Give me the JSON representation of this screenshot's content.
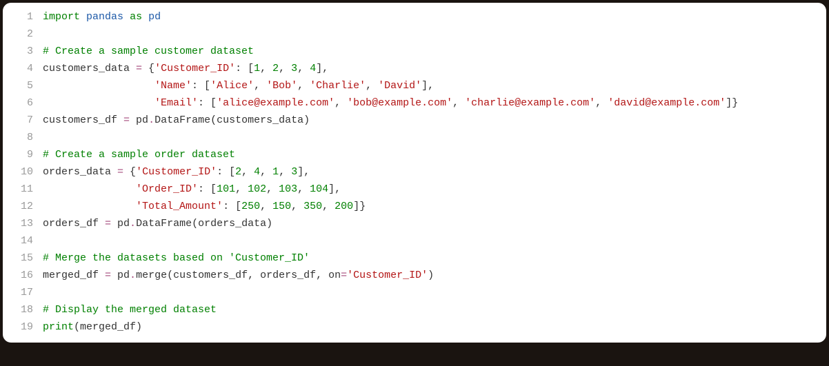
{
  "code": {
    "lines": [
      {
        "num": "1",
        "tokens": [
          {
            "cls": "kw",
            "t": "import"
          },
          {
            "cls": "pn",
            "t": " "
          },
          {
            "cls": "nm",
            "t": "pandas"
          },
          {
            "cls": "pn",
            "t": " "
          },
          {
            "cls": "kw",
            "t": "as"
          },
          {
            "cls": "pn",
            "t": " "
          },
          {
            "cls": "nm",
            "t": "pd"
          }
        ]
      },
      {
        "num": "2",
        "tokens": []
      },
      {
        "num": "3",
        "tokens": [
          {
            "cls": "cm",
            "t": "# Create a sample customer dataset"
          }
        ]
      },
      {
        "num": "4",
        "tokens": [
          {
            "cls": "pn",
            "t": "customers_data "
          },
          {
            "cls": "op",
            "t": "="
          },
          {
            "cls": "pn",
            "t": " {"
          },
          {
            "cls": "str",
            "t": "'Customer_ID'"
          },
          {
            "cls": "pn",
            "t": ": ["
          },
          {
            "cls": "num",
            "t": "1"
          },
          {
            "cls": "pn",
            "t": ", "
          },
          {
            "cls": "num",
            "t": "2"
          },
          {
            "cls": "pn",
            "t": ", "
          },
          {
            "cls": "num",
            "t": "3"
          },
          {
            "cls": "pn",
            "t": ", "
          },
          {
            "cls": "num",
            "t": "4"
          },
          {
            "cls": "pn",
            "t": "],"
          }
        ]
      },
      {
        "num": "5",
        "tokens": [
          {
            "cls": "pn",
            "t": "                  "
          },
          {
            "cls": "str",
            "t": "'Name'"
          },
          {
            "cls": "pn",
            "t": ": ["
          },
          {
            "cls": "str",
            "t": "'Alice'"
          },
          {
            "cls": "pn",
            "t": ", "
          },
          {
            "cls": "str",
            "t": "'Bob'"
          },
          {
            "cls": "pn",
            "t": ", "
          },
          {
            "cls": "str",
            "t": "'Charlie'"
          },
          {
            "cls": "pn",
            "t": ", "
          },
          {
            "cls": "str",
            "t": "'David'"
          },
          {
            "cls": "pn",
            "t": "],"
          }
        ]
      },
      {
        "num": "6",
        "tokens": [
          {
            "cls": "pn",
            "t": "                  "
          },
          {
            "cls": "str",
            "t": "'Email'"
          },
          {
            "cls": "pn",
            "t": ": ["
          },
          {
            "cls": "str",
            "t": "'alice@example.com'"
          },
          {
            "cls": "pn",
            "t": ", "
          },
          {
            "cls": "str",
            "t": "'bob@example.com'"
          },
          {
            "cls": "pn",
            "t": ", "
          },
          {
            "cls": "str",
            "t": "'charlie@example.com'"
          },
          {
            "cls": "pn",
            "t": ", "
          },
          {
            "cls": "str",
            "t": "'david@example.com'"
          },
          {
            "cls": "pn",
            "t": "]}"
          }
        ]
      },
      {
        "num": "7",
        "tokens": [
          {
            "cls": "pn",
            "t": "customers_df "
          },
          {
            "cls": "op",
            "t": "="
          },
          {
            "cls": "pn",
            "t": " pd"
          },
          {
            "cls": "op",
            "t": "."
          },
          {
            "cls": "pn",
            "t": "DataFrame(customers_data)"
          }
        ]
      },
      {
        "num": "8",
        "tokens": []
      },
      {
        "num": "9",
        "tokens": [
          {
            "cls": "cm",
            "t": "# Create a sample order dataset"
          }
        ]
      },
      {
        "num": "10",
        "tokens": [
          {
            "cls": "pn",
            "t": "orders_data "
          },
          {
            "cls": "op",
            "t": "="
          },
          {
            "cls": "pn",
            "t": " {"
          },
          {
            "cls": "str",
            "t": "'Customer_ID'"
          },
          {
            "cls": "pn",
            "t": ": ["
          },
          {
            "cls": "num",
            "t": "2"
          },
          {
            "cls": "pn",
            "t": ", "
          },
          {
            "cls": "num",
            "t": "4"
          },
          {
            "cls": "pn",
            "t": ", "
          },
          {
            "cls": "num",
            "t": "1"
          },
          {
            "cls": "pn",
            "t": ", "
          },
          {
            "cls": "num",
            "t": "3"
          },
          {
            "cls": "pn",
            "t": "],"
          }
        ]
      },
      {
        "num": "11",
        "tokens": [
          {
            "cls": "pn",
            "t": "               "
          },
          {
            "cls": "str",
            "t": "'Order_ID'"
          },
          {
            "cls": "pn",
            "t": ": ["
          },
          {
            "cls": "num",
            "t": "101"
          },
          {
            "cls": "pn",
            "t": ", "
          },
          {
            "cls": "num",
            "t": "102"
          },
          {
            "cls": "pn",
            "t": ", "
          },
          {
            "cls": "num",
            "t": "103"
          },
          {
            "cls": "pn",
            "t": ", "
          },
          {
            "cls": "num",
            "t": "104"
          },
          {
            "cls": "pn",
            "t": "],"
          }
        ]
      },
      {
        "num": "12",
        "tokens": [
          {
            "cls": "pn",
            "t": "               "
          },
          {
            "cls": "str",
            "t": "'Total_Amount'"
          },
          {
            "cls": "pn",
            "t": ": ["
          },
          {
            "cls": "num",
            "t": "250"
          },
          {
            "cls": "pn",
            "t": ", "
          },
          {
            "cls": "num",
            "t": "150"
          },
          {
            "cls": "pn",
            "t": ", "
          },
          {
            "cls": "num",
            "t": "350"
          },
          {
            "cls": "pn",
            "t": ", "
          },
          {
            "cls": "num",
            "t": "200"
          },
          {
            "cls": "pn",
            "t": "]}"
          }
        ]
      },
      {
        "num": "13",
        "tokens": [
          {
            "cls": "pn",
            "t": "orders_df "
          },
          {
            "cls": "op",
            "t": "="
          },
          {
            "cls": "pn",
            "t": " pd"
          },
          {
            "cls": "op",
            "t": "."
          },
          {
            "cls": "pn",
            "t": "DataFrame(orders_data)"
          }
        ]
      },
      {
        "num": "14",
        "tokens": []
      },
      {
        "num": "15",
        "tokens": [
          {
            "cls": "cm",
            "t": "# Merge the datasets based on 'Customer_ID'"
          }
        ]
      },
      {
        "num": "16",
        "tokens": [
          {
            "cls": "pn",
            "t": "merged_df "
          },
          {
            "cls": "op",
            "t": "="
          },
          {
            "cls": "pn",
            "t": " pd"
          },
          {
            "cls": "op",
            "t": "."
          },
          {
            "cls": "pn",
            "t": "merge(customers_df, orders_df, on"
          },
          {
            "cls": "op",
            "t": "="
          },
          {
            "cls": "str",
            "t": "'Customer_ID'"
          },
          {
            "cls": "pn",
            "t": ")"
          }
        ]
      },
      {
        "num": "17",
        "tokens": []
      },
      {
        "num": "18",
        "tokens": [
          {
            "cls": "cm",
            "t": "# Display the merged dataset"
          }
        ]
      },
      {
        "num": "19",
        "tokens": [
          {
            "cls": "fn",
            "t": "print"
          },
          {
            "cls": "pn",
            "t": "(merged_df)"
          }
        ]
      }
    ]
  }
}
